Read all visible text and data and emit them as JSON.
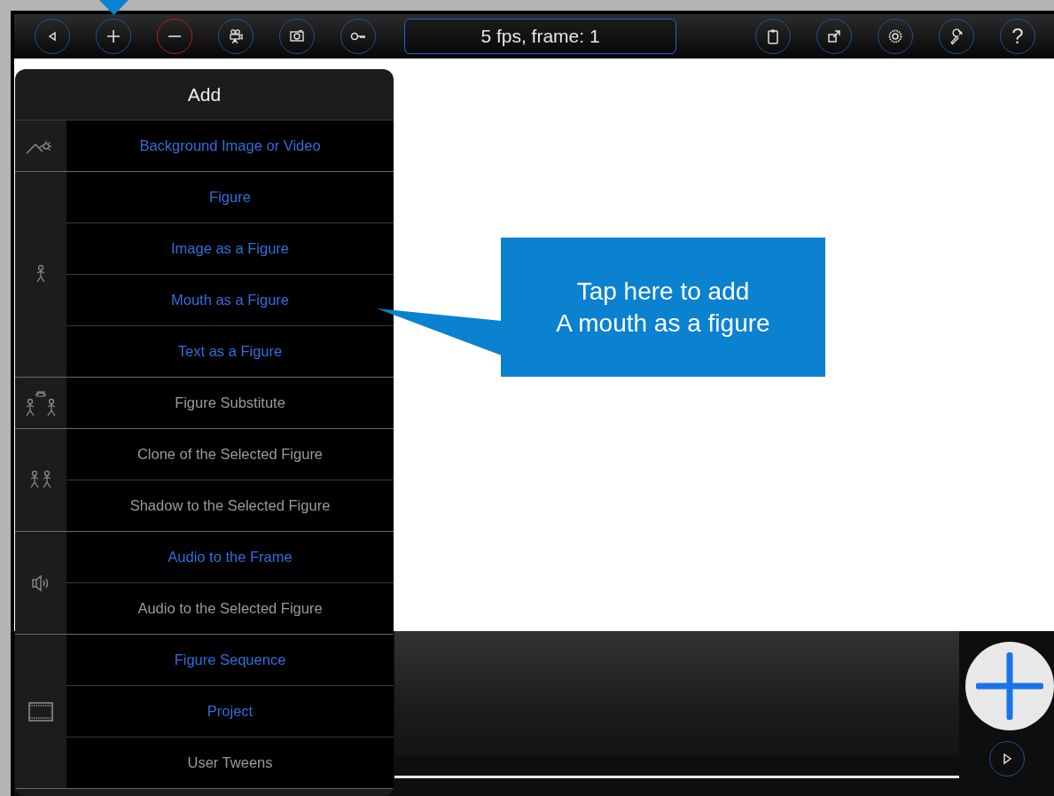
{
  "toolbar": {
    "frame_field": "5 fps, frame: 1",
    "help_label": "?"
  },
  "add_menu": {
    "title": "Add",
    "sections": [
      {
        "items": [
          {
            "label": "Background Image or Video",
            "disabled": false
          }
        ]
      },
      {
        "items": [
          {
            "label": "Figure",
            "disabled": false
          },
          {
            "label": "Image as a Figure",
            "disabled": false
          },
          {
            "label": "Mouth as a Figure",
            "disabled": false
          },
          {
            "label": "Text as a Figure",
            "disabled": false
          }
        ]
      },
      {
        "items": [
          {
            "label": "Figure Substitute",
            "disabled": true
          }
        ]
      },
      {
        "items": [
          {
            "label": "Clone of the Selected Figure",
            "disabled": true
          },
          {
            "label": "Shadow to the Selected Figure",
            "disabled": true
          }
        ]
      },
      {
        "items": [
          {
            "label": "Audio to the Frame",
            "disabled": false
          },
          {
            "label": "Audio to the Selected Figure",
            "disabled": true
          }
        ]
      },
      {
        "items": [
          {
            "label": "Figure Sequence",
            "disabled": false
          },
          {
            "label": "Project",
            "disabled": false
          },
          {
            "label": "User Tweens",
            "disabled": true
          }
        ]
      }
    ]
  },
  "callout": {
    "text": "Tap here to add\nA mouth as a figure"
  }
}
